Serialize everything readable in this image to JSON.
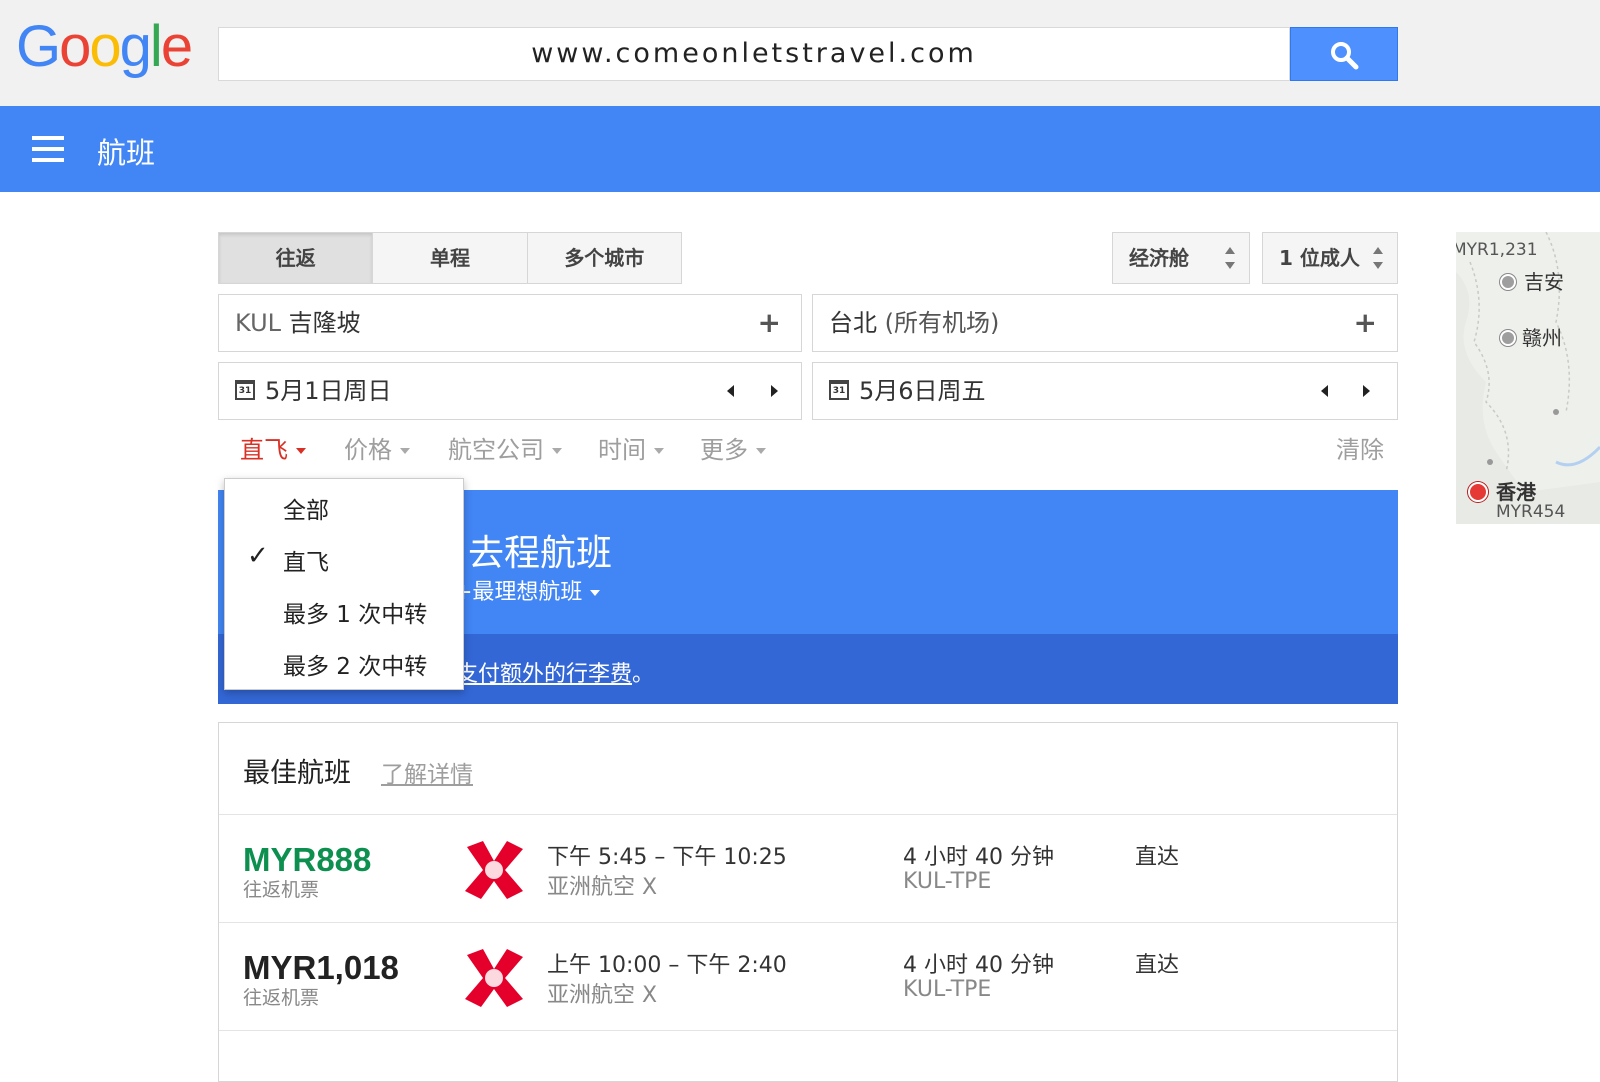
{
  "logo": {
    "letters": [
      {
        "ch": "G",
        "color": "#4285f4"
      },
      {
        "ch": "o",
        "color": "#ea4335"
      },
      {
        "ch": "o",
        "color": "#fbbc05"
      },
      {
        "ch": "g",
        "color": "#4285f4"
      },
      {
        "ch": "l",
        "color": "#34a853"
      },
      {
        "ch": "e",
        "color": "#ea4335"
      }
    ]
  },
  "search": {
    "query": "www.comeonletstravel.com",
    "button_icon": "search-icon"
  },
  "nav": {
    "menu_icon": "menu-icon",
    "title": "航班"
  },
  "trip_types": [
    {
      "label": "往返",
      "active": true
    },
    {
      "label": "单程",
      "active": false
    },
    {
      "label": "多个城市",
      "active": false
    }
  ],
  "cabin": {
    "selected": "经济舱"
  },
  "passengers": {
    "selected": "1 位成人"
  },
  "origin": {
    "code": "KUL",
    "city": "吉隆坡"
  },
  "destination": {
    "city": "台北",
    "note": "(所有机场)"
  },
  "depart_date": {
    "label": "5月1日周日",
    "icon_text": "31"
  },
  "return_date": {
    "label": "5月6日周五",
    "icon_text": "31"
  },
  "filters": {
    "stops": "直飞",
    "price": "价格",
    "airline": "航空公司",
    "time": "时间",
    "more": "更多",
    "clear": "清除"
  },
  "stops_menu": {
    "items": [
      "全部",
      "直飞",
      "最多 1 次中转",
      "最多 2 次中转"
    ],
    "checked": "直飞"
  },
  "banner": {
    "title": "去程航班",
    "subtitle": "+最理想航班",
    "note_link": "支付额外的行李费",
    "note_tail": "。"
  },
  "results": {
    "heading": "最佳航班",
    "learn_more": "了解详情",
    "flights": [
      {
        "price": "MYR888",
        "price_note": "往返机票",
        "cheapest": true,
        "times": "下午 5:45 – 下午 10:25",
        "airline": "亚洲航空 X",
        "duration": "4 小时 40 分钟",
        "route": "KUL-TPE",
        "stops": "直达"
      },
      {
        "price": "MYR1,018",
        "price_note": "往返机票",
        "cheapest": false,
        "times": "上午 10:00 – 下午 2:40",
        "airline": "亚洲航空 X",
        "duration": "4 小时 40 分钟",
        "route": "KUL-TPE",
        "stops": "直达"
      }
    ]
  },
  "map": {
    "top_price": "MYR1,231",
    "places": [
      {
        "name": "吉安"
      },
      {
        "name": "赣州"
      },
      {
        "name": "香港",
        "price": "MYR454"
      }
    ]
  },
  "colors": {
    "accent_blue": "#4285f4",
    "dark_blue": "#3367d6",
    "price_green": "#0d904f",
    "filter_red": "#d93025"
  }
}
